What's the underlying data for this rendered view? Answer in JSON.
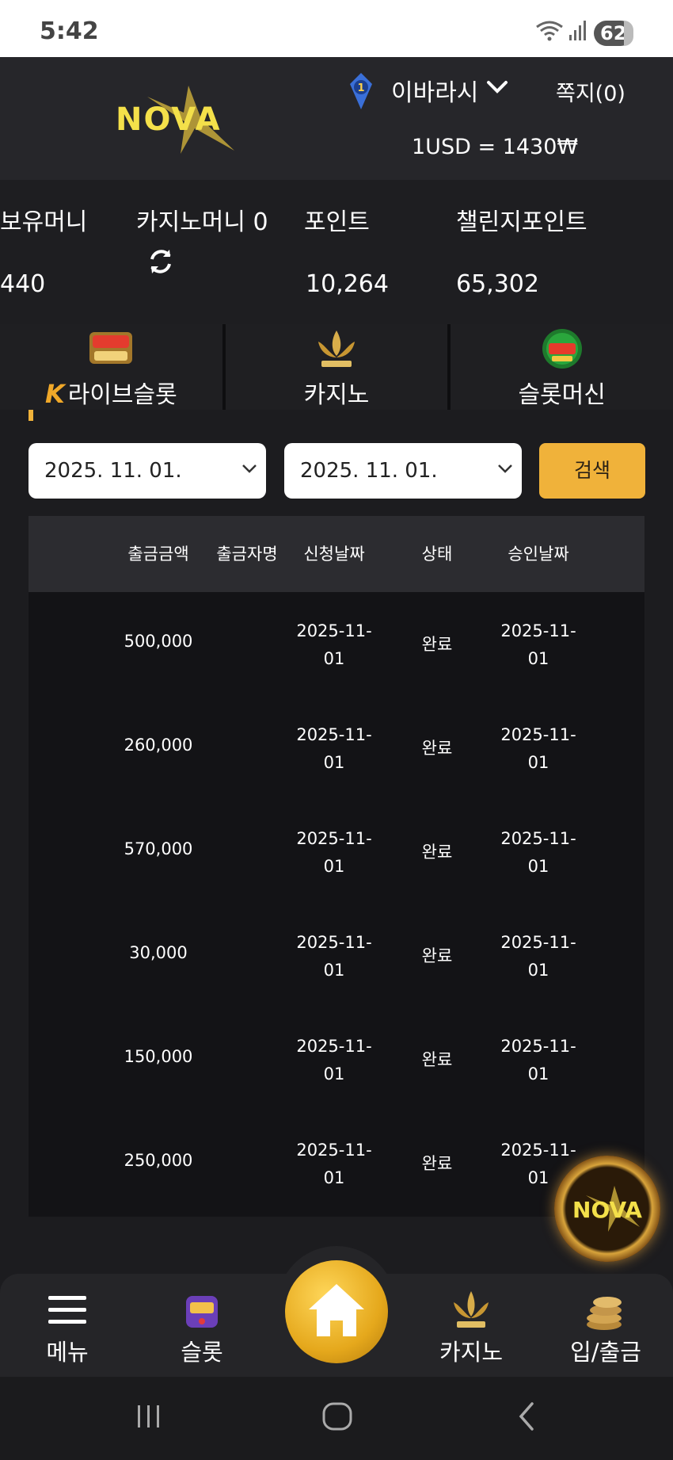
{
  "status_bar": {
    "time": "5:42",
    "battery": "62"
  },
  "header": {
    "logo_text": "NOVA",
    "username": "이바라시",
    "rank_level": "1",
    "messages_label": "쪽지(0)",
    "exchange_rate": "1USD = 1430₩"
  },
  "balance": {
    "holding_money_label": "보유머니",
    "holding_money_value": "440",
    "casino_money_label": "카지노머니 0",
    "point_label": "포인트",
    "point_value": "10,264",
    "challenge_point_label": "챌린지포인트",
    "challenge_point_value": "65,302"
  },
  "game_tabs": [
    {
      "label": "라이브슬롯",
      "icon": "live-slot-icon"
    },
    {
      "label": "카지노",
      "icon": "k-slot-icon"
    },
    {
      "label": "슬롯머신",
      "icon": "777-slots-icon"
    }
  ],
  "filters": {
    "start_date": "2025. 11. 01.",
    "end_date": "2025. 11. 01.",
    "search_label": "검색"
  },
  "table": {
    "headers": [
      "출금금액",
      "출금자명",
      "신청날짜",
      "상태",
      "승인날짜"
    ],
    "rows": [
      {
        "amount": "500,000",
        "name": "",
        "request_date_1": "2025-11-",
        "request_date_2": "01",
        "status": "완료",
        "approve_date_1": "2025-11-",
        "approve_date_2": "01"
      },
      {
        "amount": "260,000",
        "name": "",
        "request_date_1": "2025-11-",
        "request_date_2": "01",
        "status": "완료",
        "approve_date_1": "2025-11-",
        "approve_date_2": "01"
      },
      {
        "amount": "570,000",
        "name": "",
        "request_date_1": "2025-11-",
        "request_date_2": "01",
        "status": "완료",
        "approve_date_1": "2025-11-",
        "approve_date_2": "01"
      },
      {
        "amount": "30,000",
        "name": "",
        "request_date_1": "2025-11-",
        "request_date_2": "01",
        "status": "완료",
        "approve_date_1": "2025-11-",
        "approve_date_2": "01"
      },
      {
        "amount": "150,000",
        "name": "",
        "request_date_1": "2025-11-",
        "request_date_2": "01",
        "status": "완료",
        "approve_date_1": "2025-11-",
        "approve_date_2": "01"
      },
      {
        "amount": "250,000",
        "name": "",
        "request_date_1": "2025-11-",
        "request_date_2": "01",
        "status": "완료",
        "approve_date_1": "2025-11-",
        "approve_date_2": "01"
      }
    ]
  },
  "bottom_nav": {
    "menu": "메뉴",
    "slot": "슬롯",
    "home_icon": "home-icon",
    "casino": "카지노",
    "deposit_withdraw": "입/출금"
  },
  "colors": {
    "accent": "#f0b23a",
    "header_bg": "#26262a",
    "table_bg": "#131316",
    "table_header_bg": "#2c2c30"
  }
}
